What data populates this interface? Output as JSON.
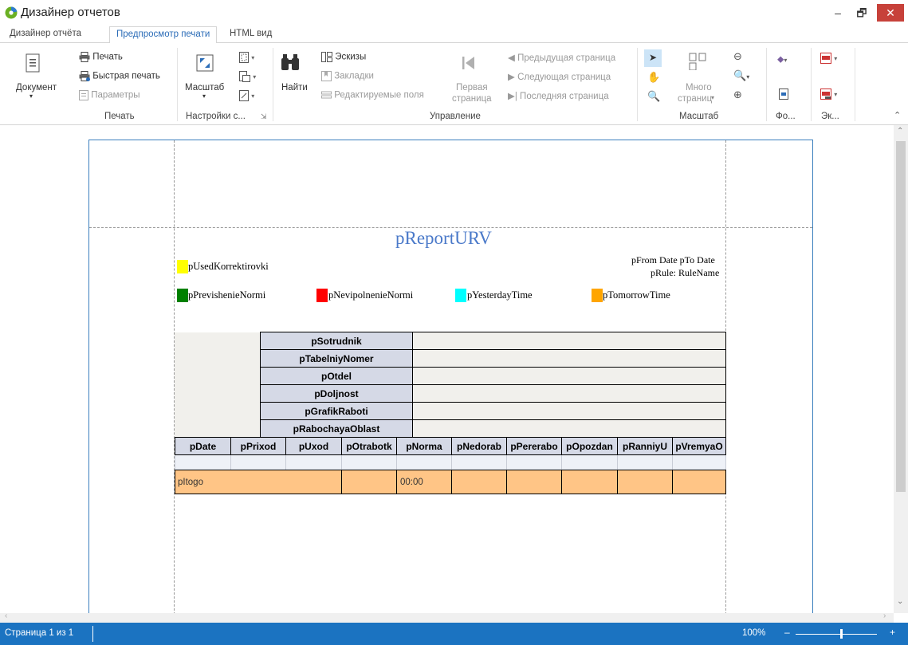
{
  "window": {
    "title": "Дизайнер отчетов",
    "min": "–",
    "max": "🗗",
    "close": "✕"
  },
  "tabs": [
    "Дизайнер отчёта",
    "Предпросмотр печати",
    "HTML вид"
  ],
  "ribbon": {
    "document": "Документ",
    "print": "Печать",
    "quick_print": "Быстрая печать",
    "params": "Параметры",
    "scale": "Масштаб",
    "find": "Найти",
    "thumbnails": "Эскизы",
    "bookmarks": "Закладки",
    "editable_fields": "Редактируемые поля",
    "first_page_1": "Первая",
    "first_page_2": "страница",
    "prev_page": "Предыдущая страница",
    "next_page": "Следующая страница",
    "last_page": "Последняя страница",
    "many_pages_1": "Много",
    "many_pages_2": "страниц",
    "groups": {
      "print": "Печать",
      "page_settings": "Настройки с...",
      "navigation": "Управление",
      "zoom": "Масштаб",
      "background": "Фо...",
      "export": "Эк..."
    }
  },
  "report": {
    "title": "pReportURV",
    "date_range": "pFrom Date pTo Date",
    "rule": "pRule: RuleName",
    "legend": [
      {
        "label": "pUsedKorrektirovki",
        "color": "#ffff00"
      },
      {
        "label": "pPrevishenieNormi",
        "color": "#008000"
      },
      {
        "label": "pNevipolnenieNormi",
        "color": "#ff0000"
      },
      {
        "label": "pYesterdayTime",
        "color": "#00ffff"
      },
      {
        "label": "pTomorrowTime",
        "color": "#ffa500"
      }
    ],
    "info_rows": [
      "pSotrudnik",
      "pTabelniyNomer",
      "pOtdel",
      "pDoljnost",
      "pGrafikRaboti",
      "pRabochayaOblast"
    ],
    "columns": [
      "pDate",
      "pPrixod",
      "pUxod",
      "pOtrabotk",
      "pNorma",
      "pNedorab",
      "pPererabo",
      "pOpozdan",
      "pRanniyU",
      "pVremyaO"
    ],
    "total_label": "pItogo",
    "total_norma": "00:00"
  },
  "status": {
    "page": "Страница 1 из 1",
    "zoom": "100%",
    "minus": "–",
    "plus": "+"
  },
  "colors": {
    "accent": "#1b73c1",
    "total_row": "#ffc586",
    "header_cell": "#d5d9e6"
  }
}
